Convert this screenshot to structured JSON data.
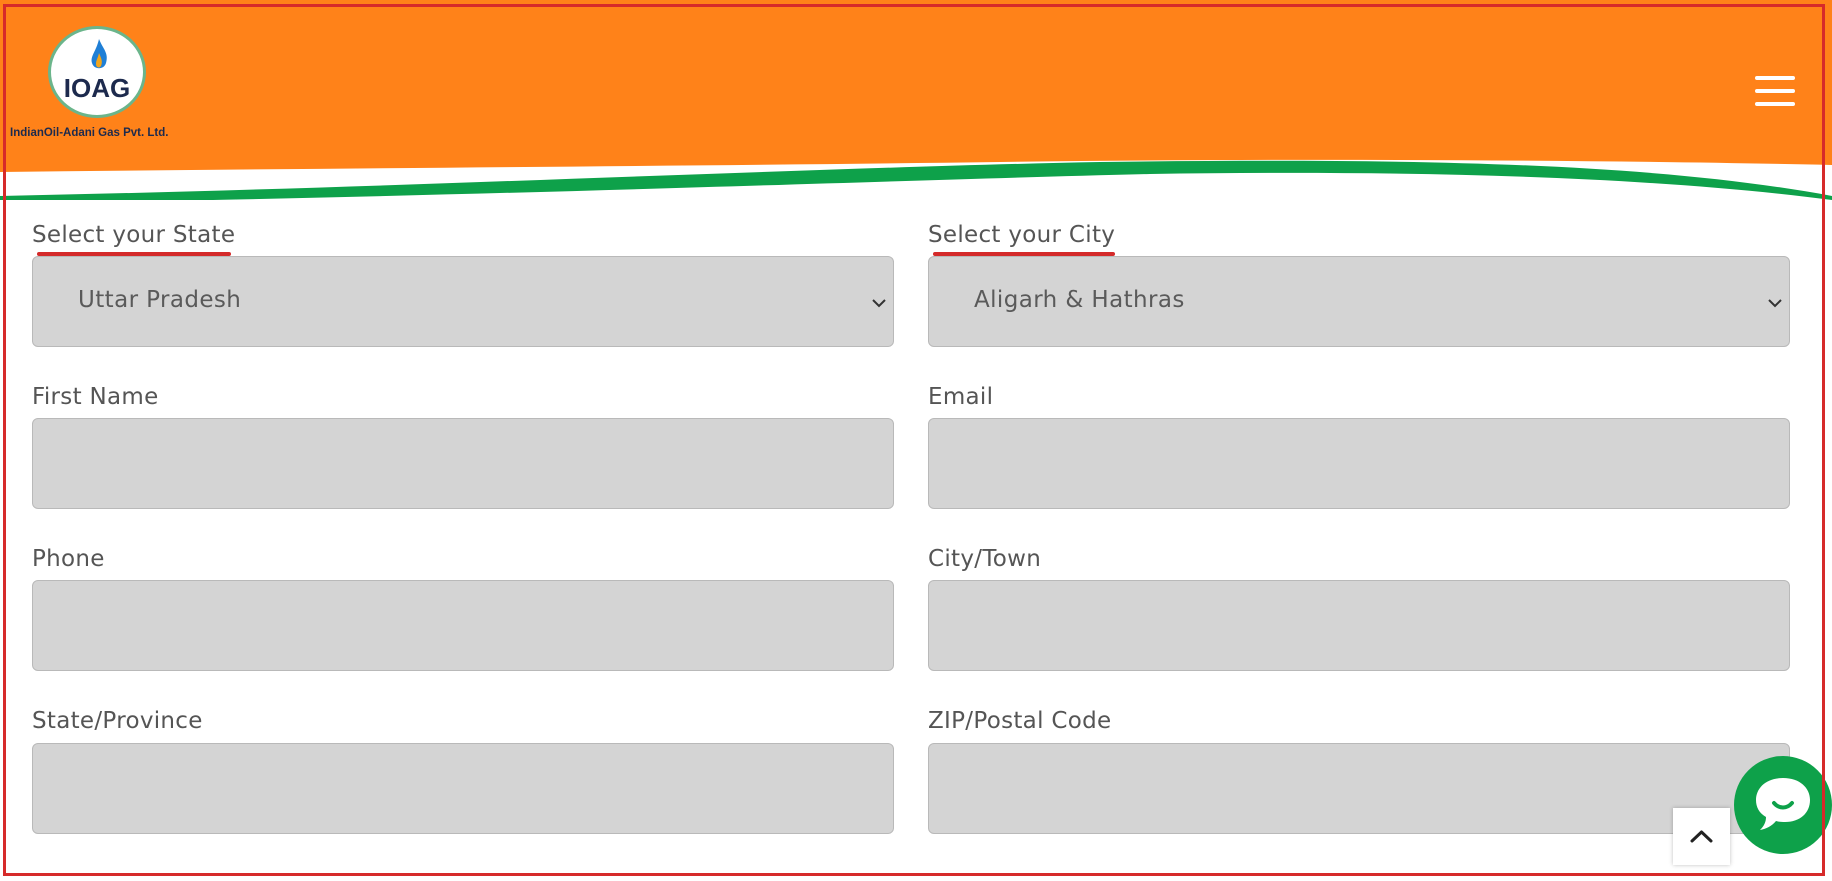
{
  "header": {
    "logo_text": "IOAG",
    "logo_caption": "IndianOil-Adani Gas Pvt. Ltd.",
    "brand_color": "#ff8219",
    "accent_color": "#0ea14a",
    "menu_icon": "hamburger-menu-icon"
  },
  "form": {
    "state_select": {
      "label": "Select your State",
      "value": "Uttar Pradesh"
    },
    "city_select": {
      "label": "Select your City",
      "value": "Aligarh & Hathras"
    },
    "first_name": {
      "label": "First Name",
      "value": ""
    },
    "email": {
      "label": "Email",
      "value": ""
    },
    "phone": {
      "label": "Phone",
      "value": ""
    },
    "city_town": {
      "label": "City/Town",
      "value": ""
    },
    "state_province": {
      "label": "State/Province",
      "value": ""
    },
    "zip": {
      "label": "ZIP/Postal Code",
      "value": ""
    }
  },
  "floating": {
    "chat_icon": "chat-bubble-icon",
    "scroll_top_icon": "chevron-up-icon"
  }
}
